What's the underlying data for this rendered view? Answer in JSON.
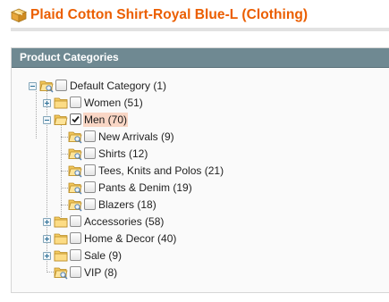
{
  "header": {
    "title": "Plaid Cotton Shirt-Royal Blue-L (Clothing)",
    "icon": "product-box-icon"
  },
  "panel": {
    "title": "Product Categories"
  },
  "tree": {
    "root": {
      "label": "Default Category (1)",
      "checked": false,
      "expanded": true
    },
    "top_level": [
      {
        "label": "Women (51)",
        "checked": false,
        "expandable": true,
        "expanded": false
      },
      {
        "label": "Men (70)",
        "checked": true,
        "expandable": true,
        "expanded": true,
        "selected": true,
        "children": [
          {
            "label": "New Arrivals (9)",
            "checked": false
          },
          {
            "label": "Shirts (12)",
            "checked": false
          },
          {
            "label": "Tees, Knits and Polos (21)",
            "checked": false
          },
          {
            "label": "Pants & Denim (19)",
            "checked": false
          },
          {
            "label": "Blazers (18)",
            "checked": false
          }
        ]
      },
      {
        "label": "Accessories (58)",
        "checked": false,
        "expandable": true,
        "expanded": false
      },
      {
        "label": "Home & Decor (40)",
        "checked": false,
        "expandable": true,
        "expanded": false
      },
      {
        "label": "Sale (9)",
        "checked": false,
        "expandable": true,
        "expanded": false
      },
      {
        "label": "VIP (8)",
        "checked": false,
        "expandable": false
      }
    ]
  },
  "colors": {
    "title_orange": "#eb5e00",
    "panel_header": "#6f8992",
    "selected_bg": "#f9d6c5"
  }
}
